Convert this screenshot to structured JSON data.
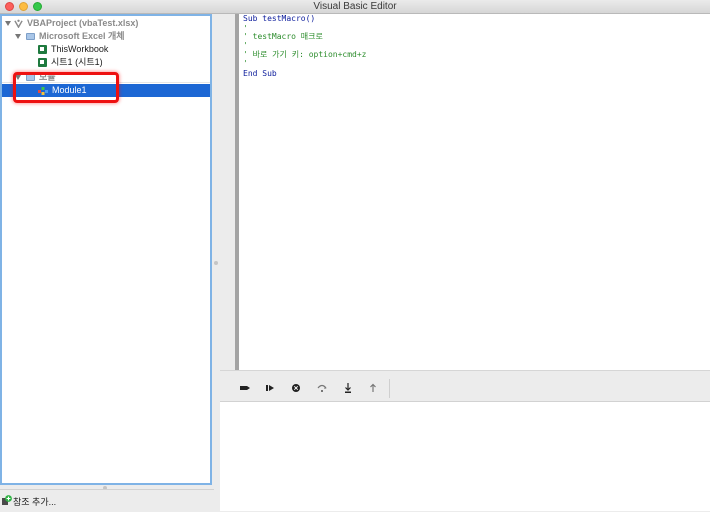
{
  "window": {
    "title": "Visual Basic Editor"
  },
  "project_tree": {
    "root_label": "VBAProject (vbaTest.xlsx)",
    "group_objects_label": "Microsoft Excel 개체",
    "this_workbook_label": "ThisWorkbook",
    "sheet_label": "시트1 (시트1)",
    "group_modules_label": "모듈",
    "module_label": "Module1"
  },
  "bottom_bar": {
    "add_reference_label": "참조 추가..."
  },
  "code": {
    "lines": [
      "Sub testMacro()",
      "'",
      "' testMacro 매크로",
      "'",
      "' 바로 가기 키: option+cmd+z",
      "'",
      "End Sub"
    ]
  },
  "toolbar": {
    "icons": [
      "breakpoint-icon",
      "continue-icon",
      "stop-icon",
      "step-over-icon",
      "step-into-icon",
      "step-out-icon"
    ]
  },
  "colors": {
    "selection": "#1c67d4",
    "highlight": "#ee1111",
    "keyword": "#0c1c9c",
    "comment": "#2d8d2d"
  }
}
